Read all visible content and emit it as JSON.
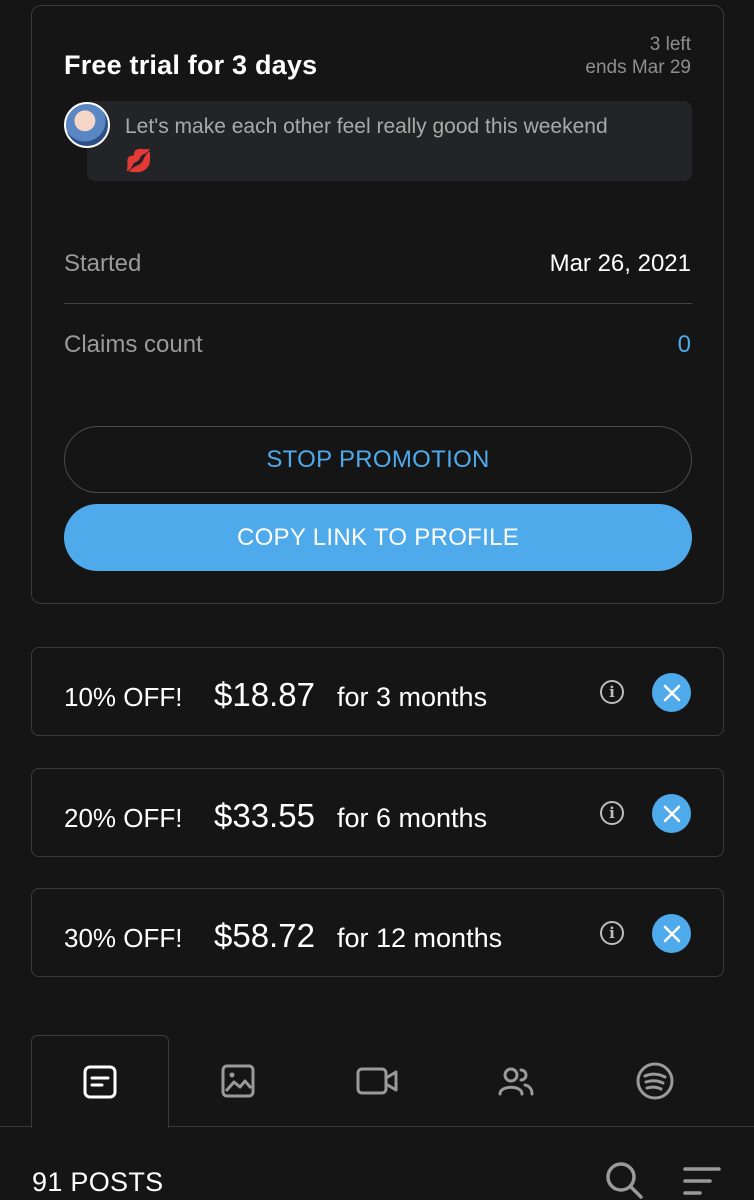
{
  "promo": {
    "title": "Free trial for 3 days",
    "left": "3 left",
    "ends": "ends Mar 29",
    "message": "Let's make each other feel really good this weekend",
    "emoji": "💋",
    "started_label": "Started",
    "started_value": "Mar 26, 2021",
    "claims_label": "Claims count",
    "claims_value": "0",
    "stop_label": "STOP PROMOTION",
    "copy_label": "COPY LINK TO PROFILE"
  },
  "discounts": [
    {
      "off": "10% OFF!",
      "price": "$18.87",
      "term": "for 3 months"
    },
    {
      "off": "20% OFF!",
      "price": "$33.55",
      "term": "for 6 months"
    },
    {
      "off": "30% OFF!",
      "price": "$58.72",
      "term": "for 12 months"
    }
  ],
  "tabs": [
    {
      "icon": "posts-icon",
      "active": true
    },
    {
      "icon": "photo-icon",
      "active": false
    },
    {
      "icon": "video-icon",
      "active": false
    },
    {
      "icon": "users-icon",
      "active": false
    },
    {
      "icon": "spotify-icon",
      "active": false
    }
  ],
  "posts_count": "91 POSTS",
  "colors": {
    "background": "#151515",
    "accent": "#4eaaea",
    "border": "#3a3a3a",
    "muted_text": "#9a9a9a"
  }
}
